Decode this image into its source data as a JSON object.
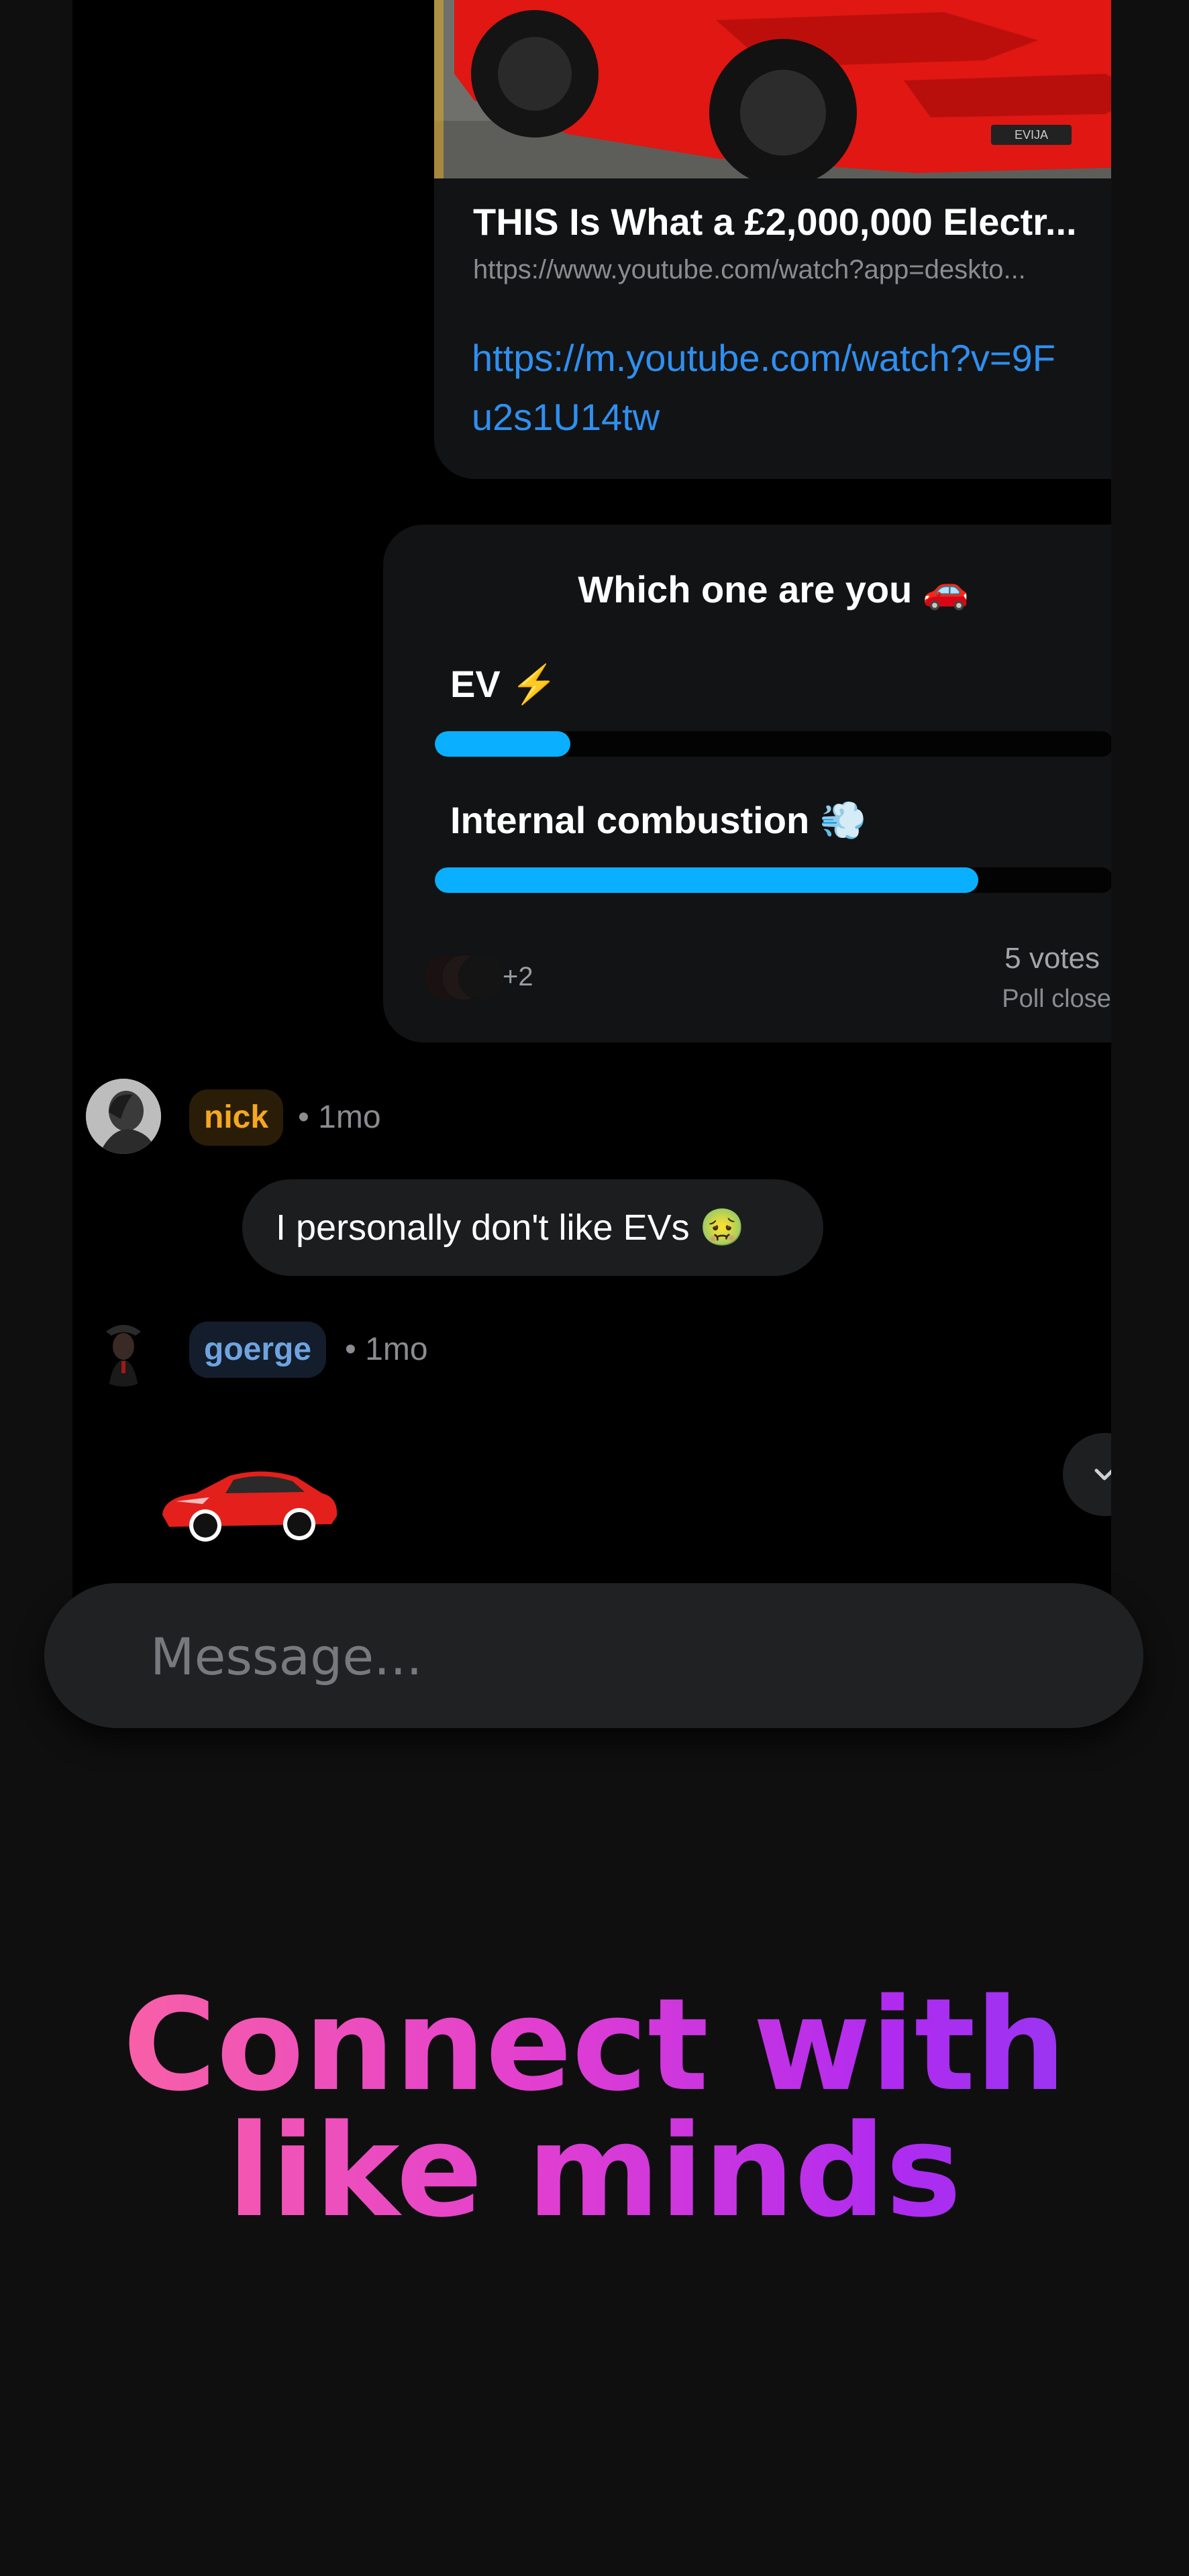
{
  "link_preview": {
    "title": "THIS Is What a £2,000,000 Electr...",
    "url": "https://www.youtube.com/watch?app=deskto...",
    "link": "https://m.youtube.com/watch?v=9Fu2s1U14tw",
    "thumbnail_icon": "red-sports-car-image",
    "plate_text": "EVIJA"
  },
  "poll": {
    "question": "Which one are you 🚗",
    "options": [
      {
        "label": "EV ⚡",
        "fraction": 0.2
      },
      {
        "label": "Internal combustion 💨",
        "fraction": 0.8
      }
    ],
    "more_voters": "+2",
    "votes": "5 votes",
    "status": "Poll closed",
    "bar_color": "#0ab0ff"
  },
  "messages": [
    {
      "user": "nick",
      "time": "• 1mo",
      "text": "I personally don't like EVs 🤢",
      "name_color": "#f5a623",
      "name_bg": "#2a1d08"
    },
    {
      "user": "goerge",
      "time": "• 1mo",
      "sticker": "red-car-sticker",
      "name_color": "#6ea3e0",
      "name_bg": "#141d2b"
    }
  ],
  "composer": {
    "placeholder": "Message..."
  },
  "hero": {
    "line1": "Connect with",
    "line2": "like minds"
  }
}
